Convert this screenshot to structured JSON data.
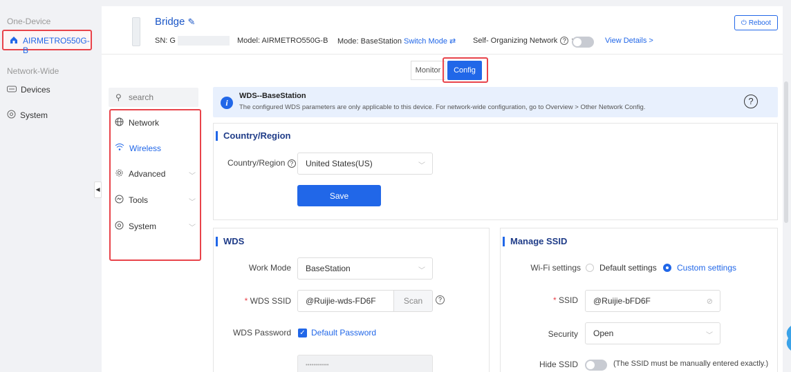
{
  "sidebar": {
    "one_device": "One-Device",
    "device_name": "AIRMETRO550G-B",
    "network_wide": "Network-Wide",
    "devices": "Devices",
    "system": "System"
  },
  "header": {
    "title": "Bridge",
    "sn_label": "SN: G",
    "model": "Model: AIRMETRO550G-B",
    "mode_label": "Mode:",
    "mode_value": "BaseStation",
    "switch_mode": "Switch Mode ⇄",
    "son_label": "Self- Organizing Network",
    "son_colon": ":",
    "view_details": "View Details >",
    "reboot": "Reboot"
  },
  "tabs": {
    "monitor": "Monitor",
    "config": "Config"
  },
  "menu": {
    "search_placeholder": "search",
    "network": "Network",
    "wireless": "Wireless",
    "advanced": "Advanced",
    "tools": "Tools",
    "system": "System"
  },
  "notice": {
    "title": "WDS--BaseStation",
    "text": "The configured WDS parameters are only applicable to this device. For network-wide configuration, go to Overview > Other Network Config."
  },
  "country": {
    "section": "Country/Region",
    "label": "Country/Region",
    "value": "United States(US)",
    "save": "Save"
  },
  "wds": {
    "section": "WDS",
    "work_mode_label": "Work Mode",
    "work_mode_value": "BaseStation",
    "ssid_label": "WDS SSID",
    "ssid_value": "@Ruijie-wds-FD6F",
    "scan": "Scan",
    "password_label": "WDS Password",
    "default_password": "Default Password",
    "password_masked": "••••••••••••"
  },
  "manage_ssid": {
    "section": "Manage SSID",
    "wifi_label": "Wi-Fi settings",
    "default_settings": "Default settings",
    "custom_settings": "Custom settings",
    "ssid_label": "SSID",
    "ssid_value": "@Ruijie-bFD6F",
    "security_label": "Security",
    "security_value": "Open",
    "hide_label": "Hide SSID",
    "hide_note": "(The SSID must be manually entered exactly.)"
  }
}
